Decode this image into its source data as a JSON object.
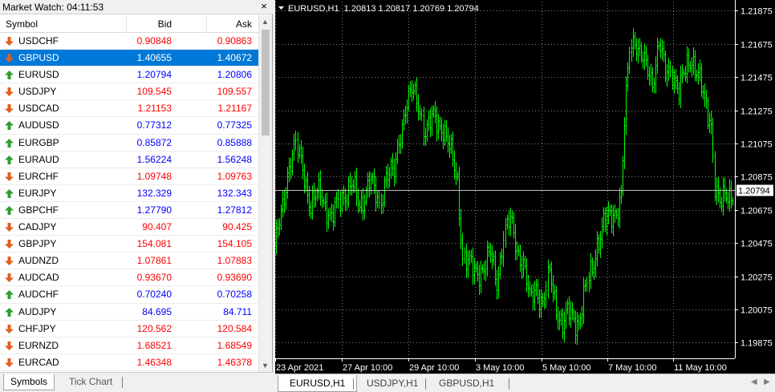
{
  "market_watch": {
    "title": "Market Watch: 04:11:53",
    "close_glyph": "×",
    "headers": {
      "symbol": "Symbol",
      "bid": "Bid",
      "ask": "Ask"
    },
    "rows": [
      {
        "symbol": "USDCHF",
        "bid": "0.90848",
        "ask": "0.90863",
        "dir": "down"
      },
      {
        "symbol": "GBPUSD",
        "bid": "1.40655",
        "ask": "1.40672",
        "dir": "down",
        "selected": true
      },
      {
        "symbol": "EURUSD",
        "bid": "1.20794",
        "ask": "1.20806",
        "dir": "up"
      },
      {
        "symbol": "USDJPY",
        "bid": "109.545",
        "ask": "109.557",
        "dir": "down"
      },
      {
        "symbol": "USDCAD",
        "bid": "1.21153",
        "ask": "1.21167",
        "dir": "down"
      },
      {
        "symbol": "AUDUSD",
        "bid": "0.77312",
        "ask": "0.77325",
        "dir": "up"
      },
      {
        "symbol": "EURGBP",
        "bid": "0.85872",
        "ask": "0.85888",
        "dir": "up"
      },
      {
        "symbol": "EURAUD",
        "bid": "1.56224",
        "ask": "1.56248",
        "dir": "up"
      },
      {
        "symbol": "EURCHF",
        "bid": "1.09748",
        "ask": "1.09763",
        "dir": "down"
      },
      {
        "symbol": "EURJPY",
        "bid": "132.329",
        "ask": "132.343",
        "dir": "up"
      },
      {
        "symbol": "GBPCHF",
        "bid": "1.27790",
        "ask": "1.27812",
        "dir": "up"
      },
      {
        "symbol": "CADJPY",
        "bid": "90.407",
        "ask": "90.425",
        "dir": "down"
      },
      {
        "symbol": "GBPJPY",
        "bid": "154.081",
        "ask": "154.105",
        "dir": "down"
      },
      {
        "symbol": "AUDNZD",
        "bid": "1.07861",
        "ask": "1.07883",
        "dir": "down"
      },
      {
        "symbol": "AUDCAD",
        "bid": "0.93670",
        "ask": "0.93690",
        "dir": "down"
      },
      {
        "symbol": "AUDCHF",
        "bid": "0.70240",
        "ask": "0.70258",
        "dir": "up"
      },
      {
        "symbol": "AUDJPY",
        "bid": "84.695",
        "ask": "84.711",
        "dir": "up"
      },
      {
        "symbol": "CHFJPY",
        "bid": "120.562",
        "ask": "120.584",
        "dir": "down"
      },
      {
        "symbol": "EURNZD",
        "bid": "1.68521",
        "ask": "1.68549",
        "dir": "down"
      },
      {
        "symbol": "EURCAD",
        "bid": "1.46348",
        "ask": "1.46378",
        "dir": "down"
      }
    ],
    "tabs": [
      {
        "label": "Symbols",
        "active": true
      },
      {
        "label": "Tick Chart",
        "active": false
      }
    ]
  },
  "chart": {
    "header": "EURUSD,H1  1.20813 1.20817 1.20769 1.20794",
    "current_price": "1.20794",
    "y_ticks": [
      "1.21875",
      "1.21675",
      "1.21475",
      "1.21275",
      "1.21075",
      "1.20875",
      "1.20675",
      "1.20475",
      "1.20275",
      "1.20075",
      "1.19875"
    ],
    "x_ticks": [
      "23 Apr 2021",
      "27 Apr 10:00",
      "29 Apr 10:00",
      "3 May 10:00",
      "5 May 10:00",
      "7 May 10:00",
      "11 May 10:00"
    ]
  },
  "chart_data": {
    "type": "bar",
    "symbol": "EURUSD",
    "timeframe": "H1",
    "ylim": [
      1.1978,
      1.2193
    ],
    "x_ticks": [
      "23 Apr 2021",
      "27 Apr 10:00",
      "29 Apr 10:00",
      "3 May 10:00",
      "5 May 10:00",
      "7 May 10:00",
      "11 May 10:00"
    ],
    "y_ticks": [
      1.21875,
      1.21675,
      1.21475,
      1.21275,
      1.21075,
      1.20875,
      1.20675,
      1.20475,
      1.20275,
      1.20075,
      1.19875
    ],
    "current": 1.20794,
    "anchors": [
      [
        0,
        1.2042
      ],
      [
        8,
        1.209
      ],
      [
        13,
        1.2105
      ],
      [
        17,
        1.2095
      ],
      [
        22,
        1.2068
      ],
      [
        28,
        1.208
      ],
      [
        35,
        1.206
      ],
      [
        40,
        1.2075
      ],
      [
        47,
        1.2082
      ],
      [
        52,
        1.207
      ],
      [
        58,
        1.2085
      ],
      [
        64,
        1.207
      ],
      [
        68,
        1.209
      ],
      [
        73,
        1.2088
      ],
      [
        76,
        1.211
      ],
      [
        80,
        1.213
      ],
      [
        84,
        1.2138
      ],
      [
        88,
        1.2132
      ],
      [
        92,
        1.2115
      ],
      [
        97,
        1.2122
      ],
      [
        103,
        1.2118
      ],
      [
        108,
        1.21
      ],
      [
        112,
        1.2085
      ],
      [
        115,
        1.204
      ],
      [
        118,
        1.2035
      ],
      [
        122,
        1.203
      ],
      [
        128,
        1.2033
      ],
      [
        132,
        1.204
      ],
      [
        136,
        1.2025
      ],
      [
        140,
        1.2052
      ],
      [
        144,
        1.206
      ],
      [
        148,
        1.2045
      ],
      [
        152,
        1.2035
      ],
      [
        156,
        1.2012
      ],
      [
        160,
        1.2022
      ],
      [
        164,
        1.201
      ],
      [
        168,
        1.2028
      ],
      [
        172,
        1.201
      ],
      [
        176,
        1.1998
      ],
      [
        180,
        1.2005
      ],
      [
        186,
        1.2
      ],
      [
        190,
        1.2018
      ],
      [
        194,
        1.2032
      ],
      [
        197,
        1.2048
      ],
      [
        201,
        1.2058
      ],
      [
        205,
        1.2063
      ],
      [
        209,
        1.2068
      ],
      [
        212,
        1.2075
      ],
      [
        214,
        1.2118
      ],
      [
        217,
        1.2165
      ],
      [
        220,
        1.2172
      ],
      [
        224,
        1.216
      ],
      [
        227,
        1.2152
      ],
      [
        231,
        1.2145
      ],
      [
        235,
        1.217
      ],
      [
        239,
        1.2148
      ],
      [
        243,
        1.2152
      ],
      [
        247,
        1.214
      ],
      [
        251,
        1.215
      ],
      [
        255,
        1.216
      ],
      [
        259,
        1.215
      ],
      [
        263,
        1.213
      ],
      [
        267,
        1.212
      ],
      [
        269,
        1.2085
      ],
      [
        272,
        1.207
      ],
      [
        276,
        1.2075
      ],
      [
        280,
        1.2079
      ]
    ]
  },
  "chart_tabs": [
    {
      "label": "EURUSD,H1",
      "active": true
    },
    {
      "label": "USDJPY,H1",
      "active": false
    },
    {
      "label": "GBPUSD,H1",
      "active": false
    }
  ],
  "icons": {
    "up_arrow": "arrow-up-icon",
    "down_arrow": "arrow-down-icon"
  },
  "colors": {
    "chart_bg": "#000000",
    "bar": "#00ff00",
    "bid_up": "#0000ff",
    "bid_down": "#ff0000",
    "selection": "#0078d7",
    "arrow_up": "#2e9e2e",
    "arrow_down": "#e06020"
  }
}
